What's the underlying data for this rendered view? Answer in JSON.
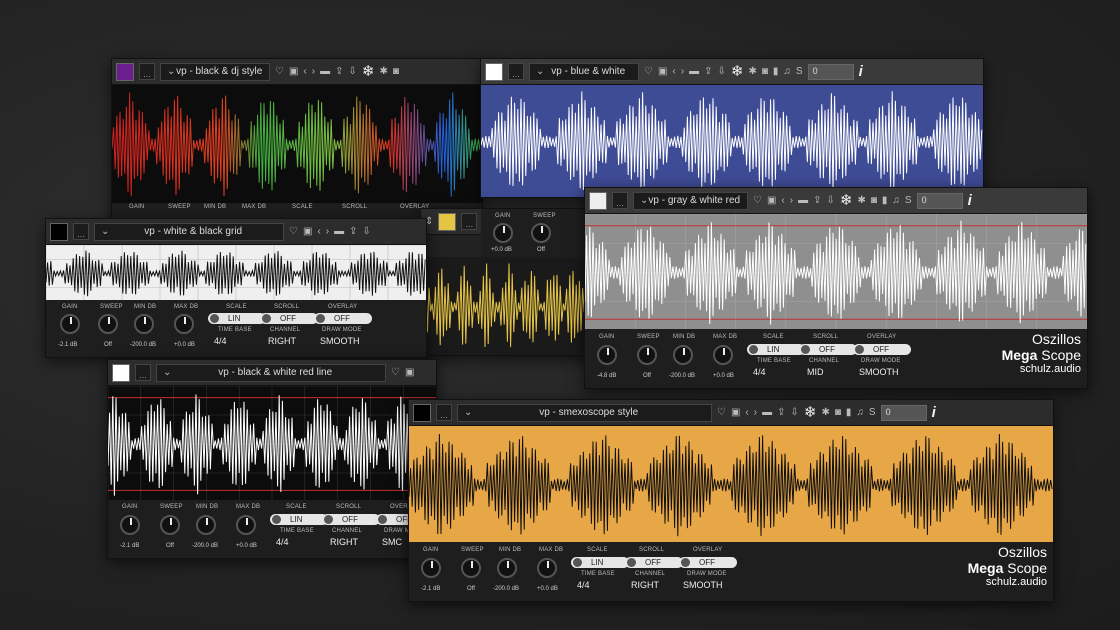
{
  "bg_color": "#262626",
  "presets": {
    "dj": "vp - black & dj style",
    "blue": "vp - blue & white",
    "grid": "vp - white & black grid",
    "gray": "vp - gray & white red line",
    "red": "vp - black & white red line",
    "smexo": "vp - smexoscope style"
  },
  "labels": {
    "gain": "GAIN",
    "sweep": "SWEEP",
    "min": "MIN dB",
    "max": "MAX dB",
    "scale": "SCALE",
    "scroll": "SCROLL",
    "overlay": "OVERLAY",
    "timebase": "TIME BASE",
    "channel": "CHANNEL",
    "drawmode": "DRAW MODE",
    "dots": "..."
  },
  "values": {
    "gain_a": "-2.1 dB",
    "gain_b": "-4.8 dB",
    "gain_c": "+0.0 dB",
    "sweep": "Off",
    "min": "-200.0 dB",
    "max": "+0.0 dB",
    "lin": "LIN",
    "off": "OFF",
    "tb": "4/4",
    "right": "RIGHT",
    "mid": "MID",
    "smooth": "SMOOTH",
    "smc": "SMC",
    "de": "DE",
    "s": "S",
    "zero": "0"
  },
  "brand": {
    "line1": "Oszillos",
    "mega": "Mega",
    "scope": "Scope",
    "site": "schulz.audio"
  },
  "colors": {
    "purple": "#6b1f8f",
    "blue": "#3e4b95",
    "yellow": "#e6c445",
    "orange": "#e8a746",
    "wave": "#ffffff",
    "wave_dark": "#111111",
    "red": "#c03030"
  },
  "icons": [
    "chevron-down-icon",
    "heart-icon",
    "save-icon",
    "prev-icon",
    "next-icon",
    "folder-icon",
    "export-icon",
    "import-icon",
    "freeze-icon",
    "auto-icon",
    "camera-icon",
    "bar-icon",
    "notes-icon",
    "info-icon"
  ]
}
